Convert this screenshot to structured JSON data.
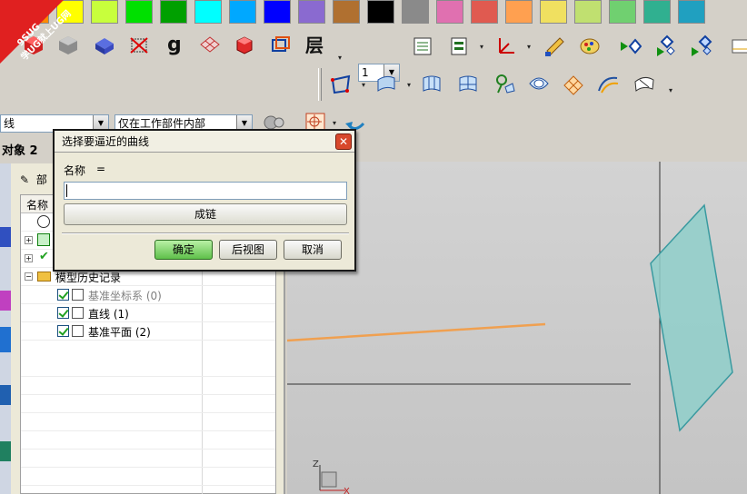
{
  "palette": [
    "#ffffff",
    "#ff8a00",
    "#ffff00",
    "#c8ff3c",
    "#00e000",
    "#00a000",
    "#00ffff",
    "#00a8ff",
    "#0000ff",
    "#8a6ad0",
    "#b07030",
    "#000000",
    "#8a8a8a",
    "#e070b0",
    "#e05a50",
    "#ffa050",
    "#f0e060",
    "#c0e070",
    "#70d070",
    "#30b090",
    "#20a0c0"
  ],
  "badge": {
    "brand": "9SUG",
    "slogan": "学UG就上UG网"
  },
  "toolbar": {
    "layer_label": "层",
    "layer_value": "1",
    "filter_left_value": "线",
    "filter_scope_value": "仅在工作部件内部"
  },
  "navigator": {
    "title": "对象 2",
    "subheader": "部",
    "column_name": "名称",
    "history_label": "模型历史记录",
    "items": [
      {
        "label": "基准坐标系 (0)",
        "dim": true
      },
      {
        "label": "直线 (1)",
        "dim": false
      },
      {
        "label": "基准平面 (2)",
        "dim": false
      }
    ]
  },
  "dialog": {
    "title": "选择要逼近的曲线",
    "name_label": "名称",
    "name_eq": "=",
    "name_value": "",
    "chain_button": "成链",
    "ok_button": "确定",
    "back_button": "后视图",
    "cancel_button": "取消"
  },
  "triad": {
    "z": "Z",
    "x": "X"
  },
  "colors": {
    "line_orange": "#f0a050",
    "plane_fill": "#8fcfca",
    "plane_stroke": "#3a9aa0",
    "ok_green": "#5fc04a",
    "close_red": "#d8482c"
  }
}
